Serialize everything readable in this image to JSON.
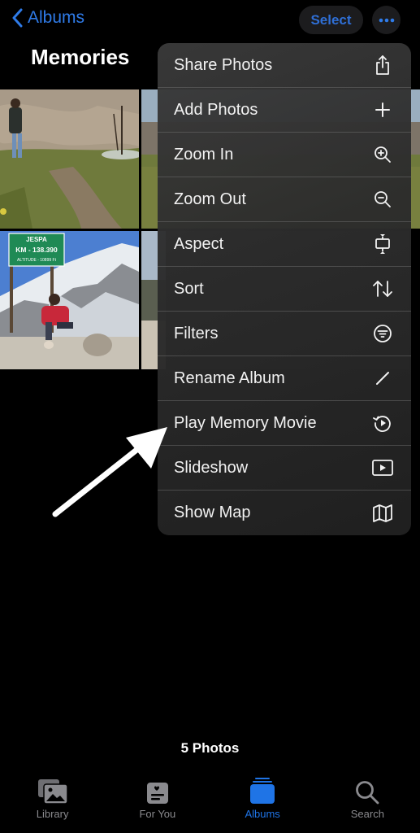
{
  "nav": {
    "back_label": "Albums",
    "select_label": "Select",
    "more_icon": "ellipsis-icon"
  },
  "page": {
    "title": "Memories",
    "photo_count": "5 Photos"
  },
  "colors": {
    "accent": "#2f7be8",
    "background": "#000000",
    "menu_background": "#2c2c2c",
    "tab_inactive": "#8a8a8e"
  },
  "photos": [
    {
      "description": "Man standing on grassy trail in mountain valley"
    },
    {
      "description": "Mountain valley with trees (partially hidden)"
    },
    {
      "description": "Man sitting by Jespa milestone sign with snowy mountains"
    },
    {
      "description": "Snowy mountain scene (partially hidden)"
    }
  ],
  "sign": {
    "line1": "JESPA",
    "line2": "KM - 138.390",
    "line3": "ALTITUDE - 10899 Ft"
  },
  "menu": {
    "items": [
      {
        "label": "Share Photos",
        "icon": "share-icon"
      },
      {
        "label": "Add Photos",
        "icon": "plus-icon"
      },
      {
        "label": "Zoom In",
        "icon": "zoom-in-icon"
      },
      {
        "label": "Zoom Out",
        "icon": "zoom-out-icon"
      },
      {
        "label": "Aspect",
        "icon": "aspect-icon"
      },
      {
        "label": "Sort",
        "icon": "sort-icon"
      },
      {
        "label": "Filters",
        "icon": "filter-icon"
      },
      {
        "label": "Rename Album",
        "icon": "pencil-icon"
      },
      {
        "label": "Play Memory Movie",
        "icon": "memory-movie-icon"
      },
      {
        "label": "Slideshow",
        "icon": "slideshow-icon"
      },
      {
        "label": "Show Map",
        "icon": "map-icon"
      }
    ]
  },
  "tabs": [
    {
      "label": "Library",
      "icon": "library-icon",
      "active": false
    },
    {
      "label": "For You",
      "icon": "for-you-icon",
      "active": false
    },
    {
      "label": "Albums",
      "icon": "albums-icon",
      "active": true
    },
    {
      "label": "Search",
      "icon": "search-icon",
      "active": false
    }
  ]
}
